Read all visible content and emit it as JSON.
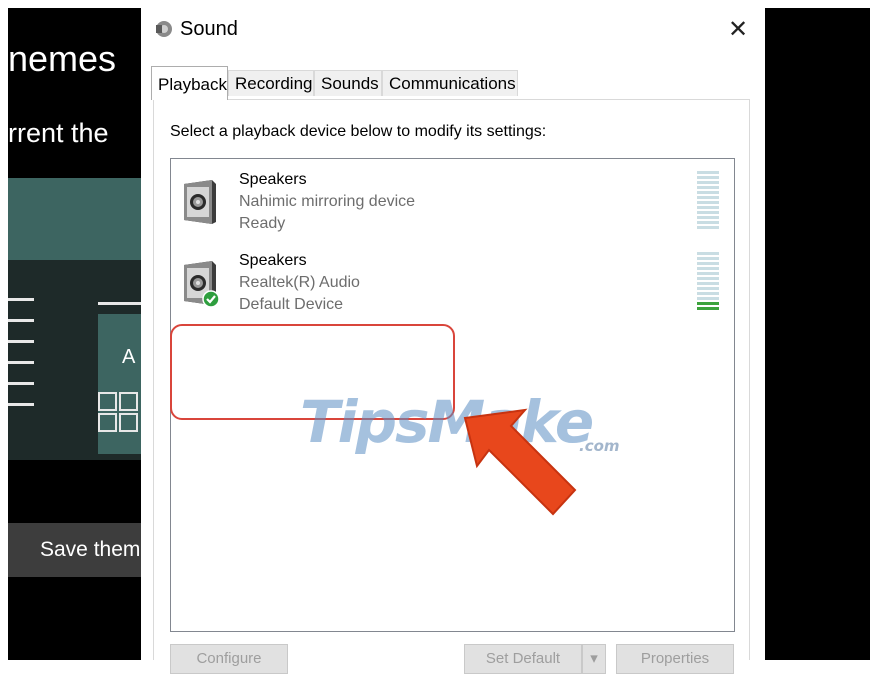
{
  "background_window": {
    "title": "nemes",
    "subtitle": "rrent the",
    "tile_letter": "A",
    "save_button": "Save them",
    "accent_color": "#3d6561"
  },
  "dialog": {
    "title": "Sound",
    "close_glyph": "✕",
    "tabs": [
      {
        "label": "Playback",
        "active": true
      },
      {
        "label": "Recording",
        "active": false
      },
      {
        "label": "Sounds",
        "active": false
      },
      {
        "label": "Communications",
        "active": false
      }
    ],
    "instruction": "Select a playback device below to modify its settings:",
    "devices": [
      {
        "name": "Speakers",
        "description": "Nahimic mirroring device",
        "status": "Ready",
        "icon": "speaker-icon",
        "is_default": false
      },
      {
        "name": "Speakers",
        "description": "Realtek(R) Audio",
        "status": "Default Device",
        "icon": "speaker-icon",
        "is_default": true,
        "badge_icon": "check-badge-icon"
      }
    ],
    "buttons": {
      "configure": "Configure",
      "set_default": "Set Default",
      "properties": "Properties"
    }
  },
  "watermark": {
    "text": "TipsMake",
    "suffix": ".com"
  },
  "colors": {
    "highlight_border": "#d9453b",
    "arrow": "#e8471c",
    "meter_idle": "#c9dde3",
    "meter_active": "#3ca33c",
    "check_badge": "#2e9e3e"
  }
}
